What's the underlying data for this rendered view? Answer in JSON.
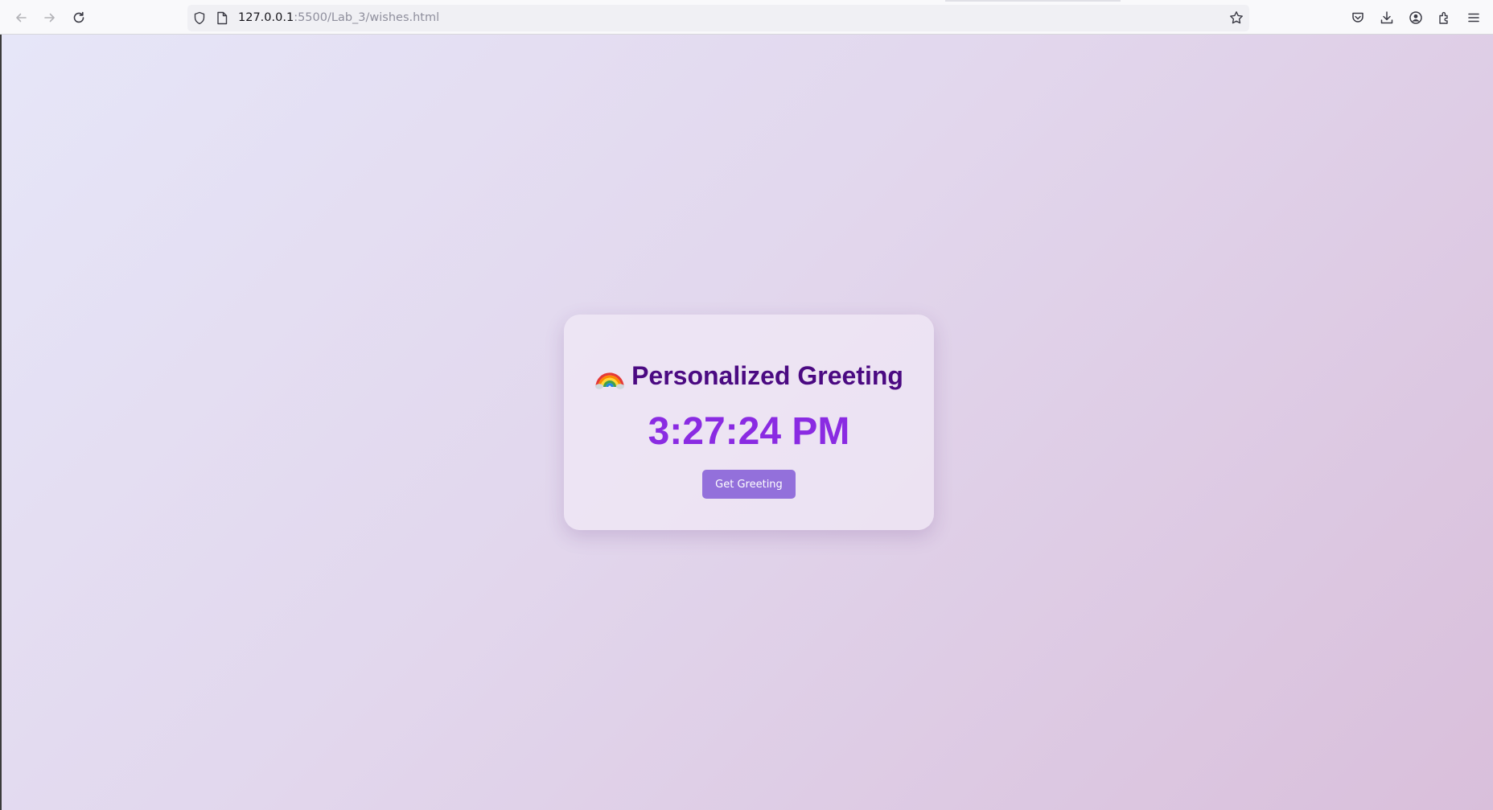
{
  "browser": {
    "url_host": "127.0.0.1",
    "url_rest": ":5500/Lab_3/wishes.html",
    "icons": {
      "back": "back-arrow-icon",
      "forward": "forward-arrow-icon",
      "reload": "reload-icon",
      "tracking": "shield-icon",
      "page": "page-icon",
      "bookmark": "star-icon",
      "pocket": "pocket-icon",
      "downloads": "download-icon",
      "account": "account-icon",
      "extensions": "extensions-icon",
      "menu": "hamburger-menu-icon"
    }
  },
  "page": {
    "title": "Personalized Greeting",
    "title_icon": "rainbow-icon",
    "clock": "3:27:24 PM",
    "button_label": "Get Greeting",
    "colors": {
      "title": "#4b0a82",
      "clock": "#8a2be2",
      "button": "#9370db"
    }
  }
}
